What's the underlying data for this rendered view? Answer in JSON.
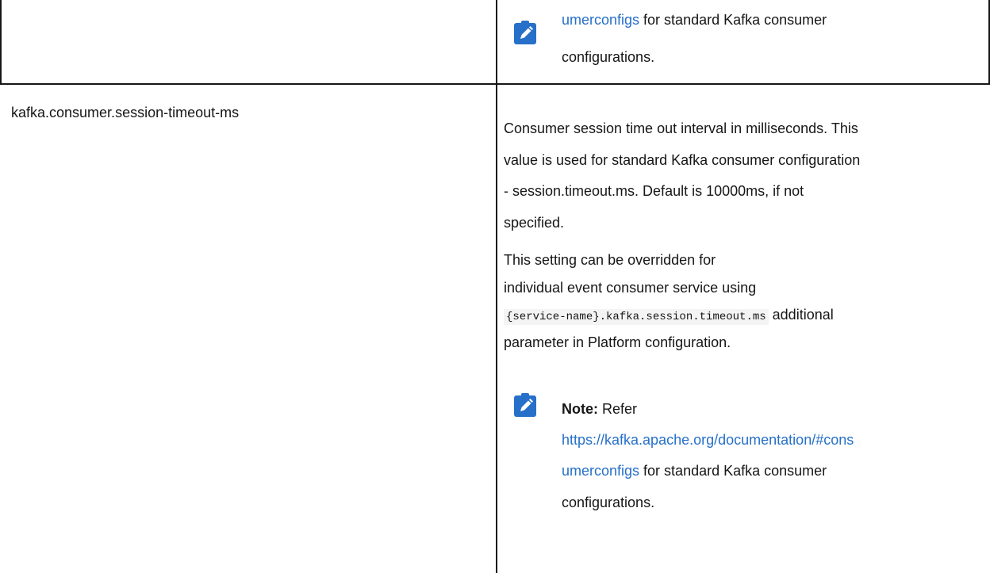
{
  "top_cell": {
    "note_line1_link": "umerconfigs",
    "note_line1_rest": " for standard Kafka consumer",
    "note_line2": "configurations."
  },
  "row": {
    "parameter": "kafka.consumer.session-timeout-ms",
    "description_lines": [
      "Consumer session time out interval in milliseconds. This",
      "value is used for standard Kafka consumer configuration",
      "- session.timeout.ms. Default is 10000ms, if not",
      "specified."
    ],
    "override_lines": [
      "This setting can be overridden for",
      "individual event consumer service using"
    ],
    "override_code": "{service-name}.kafka.session.timeout.ms",
    "override_code_suffix": " additional",
    "override_last": "parameter in Platform configuration.",
    "note": {
      "label": "Note:",
      "refer": " Refer",
      "link_line1": "https://kafka.apache.org/documentation/#cons",
      "link_line2": "umerconfigs",
      "rest_line2": " for standard Kafka consumer",
      "line3": "configurations."
    }
  },
  "colors": {
    "link": "#2670c9",
    "note_icon": "#2670c9",
    "text": "#161616",
    "border": "#161616"
  },
  "icons": {
    "note": "pencil-note-icon"
  }
}
